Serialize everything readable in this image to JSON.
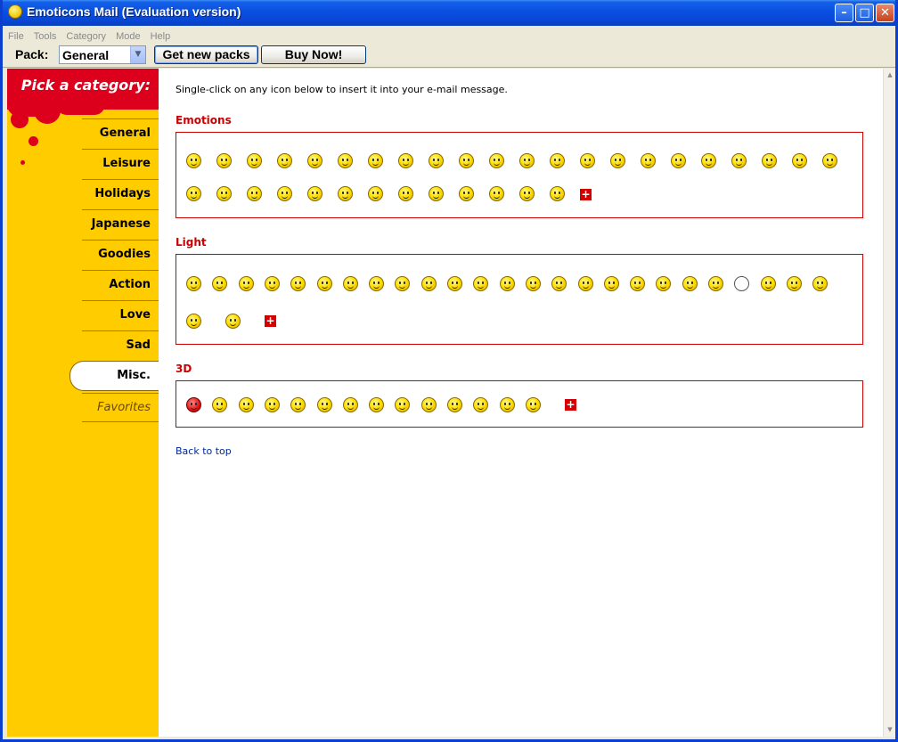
{
  "window": {
    "title": "Emoticons Mail  (Evaluation version)",
    "app_icon": "smiley-icon"
  },
  "menu": [
    "File",
    "Tools",
    "Category",
    "Mode",
    "Help"
  ],
  "toolbar": {
    "pack_label": "Pack:",
    "pack_value": "General",
    "get_packs_label": "Get new packs",
    "buy_label": "Buy Now!"
  },
  "sidebar": {
    "header": "Pick a category:",
    "categories": [
      "General",
      "Leisure",
      "Holidays",
      "Japanese",
      "Goodies",
      "Action",
      "Love",
      "Sad",
      "Misc.",
      "Favorites"
    ],
    "active": "Misc."
  },
  "content": {
    "intro": "Single-click on any icon below to insert it into your e-mail message.",
    "sections": [
      {
        "title": "Emotions",
        "rows": [
          22,
          13
        ],
        "more_icon": "plus-icon"
      },
      {
        "title": "Light",
        "rows": [
          25,
          2
        ],
        "more_icon": "plus-icon"
      },
      {
        "title": "3D",
        "rows": [
          14
        ],
        "more_icon": "plus-icon"
      }
    ],
    "back_to_top": "Back to top"
  },
  "colors": {
    "accent_red": "#cc0000",
    "sidebar_yellow": "#ffcc00",
    "header_red": "#dd001c",
    "link_blue": "#00289a"
  }
}
